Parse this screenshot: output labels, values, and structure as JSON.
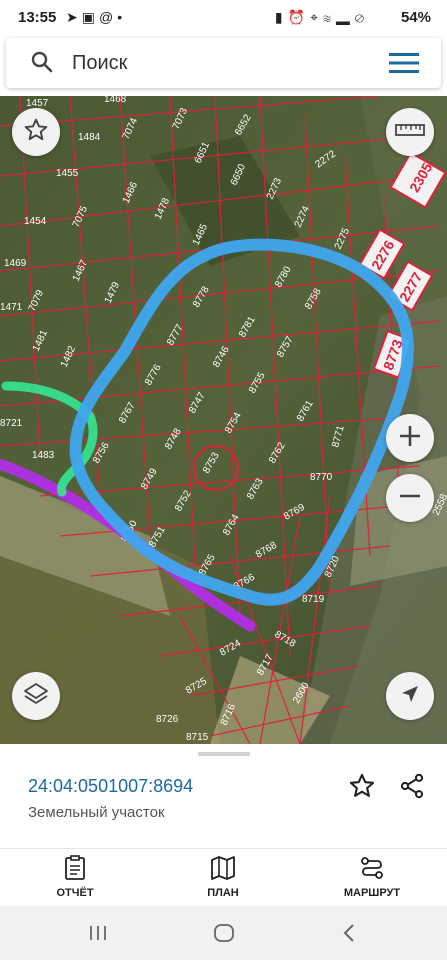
{
  "status": {
    "time": "13:55",
    "battery": "54%"
  },
  "search": {
    "placeholder": "Поиск"
  },
  "map": {
    "parcels": [
      "1457",
      "1468",
      "1484",
      "7074",
      "7073",
      "6652",
      "1455",
      "6651",
      "2272",
      "6650",
      "2273",
      "2305",
      "1454",
      "7075",
      "1466",
      "1478",
      "2274",
      "1465",
      "2275",
      "2276",
      "1469",
      "1467",
      "1479",
      "8780",
      "8758",
      "2277",
      "7079",
      "8778",
      "1481",
      "8777",
      "8781",
      "8757",
      "8773",
      "1482",
      "8776",
      "8746",
      "8755",
      "8767",
      "8747",
      "8761",
      "8771",
      "8748",
      "8754",
      "8756",
      "8753",
      "8762",
      "1483",
      "8749",
      "8752",
      "8763",
      "8770",
      "8751",
      "8764",
      "8769",
      "8722",
      "8750",
      "8765",
      "8768",
      "8720",
      "8766",
      "8719",
      "8718",
      "8724",
      "8717",
      "8725",
      "2600",
      "8726",
      "8716",
      "8715",
      "8721",
      "1471",
      "2558"
    ],
    "colors": {
      "parcel_line": "#e0203a",
      "outline_blue": "#3fa7ee",
      "line_green": "#35e08e",
      "line_purple": "#b12ee6"
    }
  },
  "parcel_info": {
    "cadastral_number": "24:04:0501007:8694",
    "type": "Земельный участок"
  },
  "tabs": [
    {
      "label": "ОТЧЁТ",
      "icon": "report-icon"
    },
    {
      "label": "ПЛАН",
      "icon": "map-icon"
    },
    {
      "label": "МАРШРУТ",
      "icon": "route-icon"
    }
  ]
}
